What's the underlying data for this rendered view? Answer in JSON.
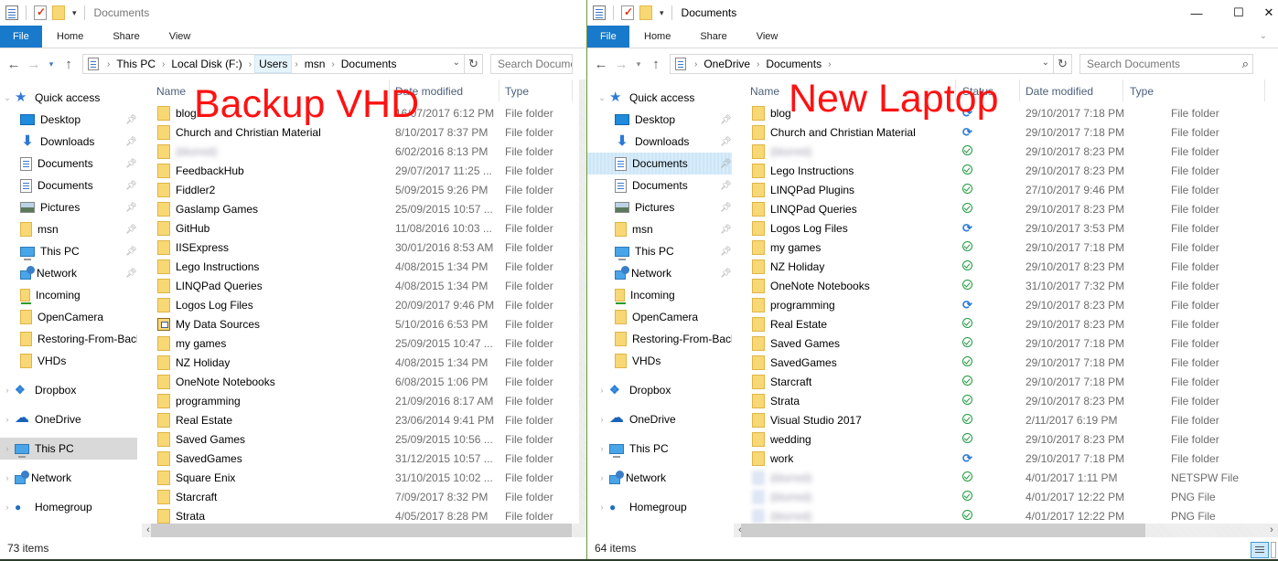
{
  "left_window": {
    "title": "Documents",
    "ribbon_tabs": [
      "File",
      "Home",
      "Share",
      "View"
    ],
    "breadcrumb": [
      "This PC",
      "Local Disk (F:)",
      "Users",
      "msn",
      "Documents"
    ],
    "search_placeholder": "Search Documents",
    "overlay_label": "Backup VHD",
    "columns": {
      "name": "Name",
      "date": "Date modified",
      "type": "Type"
    },
    "sidebar": {
      "quick_access": "Quick access",
      "pinned": [
        {
          "label": "Desktop",
          "icon": "desktop-icon",
          "pinned": true
        },
        {
          "label": "Downloads",
          "icon": "downloads-icon",
          "pinned": true
        },
        {
          "label": "Documents",
          "icon": "documents-icon",
          "pinned": true
        },
        {
          "label": "Documents",
          "icon": "documents-icon",
          "pinned": true
        },
        {
          "label": "Pictures",
          "icon": "pictures-icon",
          "pinned": true
        },
        {
          "label": "msn",
          "icon": "folder-icon",
          "pinned": true
        },
        {
          "label": "This PC",
          "icon": "this-pc-icon",
          "pinned": true
        },
        {
          "label": "Network",
          "icon": "network-icon",
          "pinned": true
        },
        {
          "label": "Incoming",
          "icon": "shared-folder-icon",
          "pinned": false
        },
        {
          "label": "OpenCamera",
          "icon": "folder-icon",
          "pinned": false
        },
        {
          "label": "Restoring-From-Backup",
          "icon": "folder-icon",
          "pinned": false
        },
        {
          "label": "VHDs",
          "icon": "folder-icon",
          "pinned": false
        }
      ],
      "roots": [
        {
          "label": "Dropbox",
          "icon": "dropbox-icon"
        },
        {
          "label": "OneDrive",
          "icon": "onedrive-icon"
        },
        {
          "label": "This PC",
          "icon": "this-pc-icon",
          "selected": true
        },
        {
          "label": "Network",
          "icon": "network-icon"
        },
        {
          "label": "Homegroup",
          "icon": "homegroup-icon"
        }
      ]
    },
    "files": [
      {
        "name": "blog",
        "date": "16/07/2017 6:12 PM",
        "type": "File folder"
      },
      {
        "name": "Church and Christian Material",
        "date": "8/10/2017 8:37 PM",
        "type": "File folder"
      },
      {
        "name": "(blurred)",
        "date": "6/02/2016 8:13 PM",
        "type": "File folder",
        "blurred": true
      },
      {
        "name": "FeedbackHub",
        "date": "29/07/2017 11:25 ...",
        "type": "File folder"
      },
      {
        "name": "Fiddler2",
        "date": "5/09/2015 9:26 PM",
        "type": "File folder"
      },
      {
        "name": "Gaslamp Games",
        "date": "25/09/2015 10:57 ...",
        "type": "File folder"
      },
      {
        "name": "GitHub",
        "date": "11/08/2016 10:03 ...",
        "type": "File folder"
      },
      {
        "name": "IISExpress",
        "date": "30/01/2016 8:53 AM",
        "type": "File folder"
      },
      {
        "name": "Lego Instructions",
        "date": "4/08/2015 1:34 PM",
        "type": "File folder"
      },
      {
        "name": "LINQPad Queries",
        "date": "4/08/2015 1:34 PM",
        "type": "File folder"
      },
      {
        "name": "Logos Log Files",
        "date": "20/09/2017 9:46 PM",
        "type": "File folder"
      },
      {
        "name": "My Data Sources",
        "date": "5/10/2016 6:53 PM",
        "type": "File folder",
        "special": true
      },
      {
        "name": "my games",
        "date": "25/09/2015 10:47 ...",
        "type": "File folder"
      },
      {
        "name": "NZ Holiday",
        "date": "4/08/2015 1:34 PM",
        "type": "File folder"
      },
      {
        "name": "OneNote Notebooks",
        "date": "6/08/2015 1:06 PM",
        "type": "File folder"
      },
      {
        "name": "programming",
        "date": "21/09/2016 8:17 AM",
        "type": "File folder"
      },
      {
        "name": "Real Estate",
        "date": "23/06/2014 9:41 PM",
        "type": "File folder"
      },
      {
        "name": "Saved Games",
        "date": "25/09/2015 10:56 ...",
        "type": "File folder"
      },
      {
        "name": "SavedGames",
        "date": "31/12/2015 10:57 ...",
        "type": "File folder"
      },
      {
        "name": "Square Enix",
        "date": "31/10/2015 10:02 ...",
        "type": "File folder"
      },
      {
        "name": "Starcraft",
        "date": "7/09/2017 8:32 PM",
        "type": "File folder"
      },
      {
        "name": "Strata",
        "date": "4/05/2017 8:28 PM",
        "type": "File folder"
      }
    ],
    "status": "73 items"
  },
  "right_window": {
    "title": "Documents",
    "ribbon_tabs": [
      "File",
      "Home",
      "Share",
      "View"
    ],
    "breadcrumb": [
      "OneDrive",
      "Documents"
    ],
    "search_placeholder": "Search Documents",
    "overlay_label": "New Laptop",
    "columns": {
      "name": "Name",
      "status": "Status",
      "date": "Date modified",
      "type": "Type"
    },
    "window_buttons": {
      "minimize": "—",
      "maximize": "☐",
      "close": "✕"
    },
    "sidebar": {
      "quick_access": "Quick access",
      "pinned": [
        {
          "label": "Desktop",
          "icon": "desktop-icon",
          "pinned": true
        },
        {
          "label": "Downloads",
          "icon": "downloads-icon",
          "pinned": true
        },
        {
          "label": "Documents",
          "icon": "documents-icon",
          "pinned": true,
          "selected": true
        },
        {
          "label": "Documents",
          "icon": "documents-icon",
          "pinned": true
        },
        {
          "label": "Pictures",
          "icon": "pictures-icon",
          "pinned": true
        },
        {
          "label": "msn",
          "icon": "folder-icon",
          "pinned": true
        },
        {
          "label": "This PC",
          "icon": "this-pc-icon",
          "pinned": true
        },
        {
          "label": "Network",
          "icon": "network-icon",
          "pinned": true
        },
        {
          "label": "Incoming",
          "icon": "shared-folder-icon",
          "pinned": false
        },
        {
          "label": "OpenCamera",
          "icon": "folder-icon",
          "pinned": false
        },
        {
          "label": "Restoring-From-Backup",
          "icon": "folder-icon",
          "pinned": false
        },
        {
          "label": "VHDs",
          "icon": "folder-icon",
          "pinned": false
        }
      ],
      "roots": [
        {
          "label": "Dropbox",
          "icon": "dropbox-icon"
        },
        {
          "label": "OneDrive",
          "icon": "onedrive-icon"
        },
        {
          "label": "This PC",
          "icon": "this-pc-icon"
        },
        {
          "label": "Network",
          "icon": "network-icon"
        },
        {
          "label": "Homegroup",
          "icon": "homegroup-icon"
        }
      ]
    },
    "files": [
      {
        "name": "blog",
        "status": "sync",
        "date": "29/10/2017 7:18 PM",
        "type": "File folder"
      },
      {
        "name": "Church and Christian Material",
        "status": "sync",
        "date": "29/10/2017 7:18 PM",
        "type": "File folder"
      },
      {
        "name": "(blurred)",
        "status": "ok",
        "date": "29/10/2017 8:23 PM",
        "type": "File folder",
        "blurred": true
      },
      {
        "name": "Lego Instructions",
        "status": "ok",
        "date": "29/10/2017 8:23 PM",
        "type": "File folder"
      },
      {
        "name": "LINQPad Plugins",
        "status": "ok",
        "date": "27/10/2017 9:46 PM",
        "type": "File folder"
      },
      {
        "name": "LINQPad Queries",
        "status": "ok",
        "date": "29/10/2017 8:23 PM",
        "type": "File folder"
      },
      {
        "name": "Logos Log Files",
        "status": "sync",
        "date": "29/10/2017 3:53 PM",
        "type": "File folder"
      },
      {
        "name": "my games",
        "status": "ok",
        "date": "29/10/2017 7:18 PM",
        "type": "File folder"
      },
      {
        "name": "NZ Holiday",
        "status": "ok",
        "date": "29/10/2017 8:23 PM",
        "type": "File folder"
      },
      {
        "name": "OneNote Notebooks",
        "status": "ok",
        "date": "31/10/2017 7:32 PM",
        "type": "File folder"
      },
      {
        "name": "programming",
        "status": "sync",
        "date": "29/10/2017 8:23 PM",
        "type": "File folder"
      },
      {
        "name": "Real Estate",
        "status": "ok",
        "date": "29/10/2017 8:23 PM",
        "type": "File folder"
      },
      {
        "name": "Saved Games",
        "status": "ok",
        "date": "29/10/2017 7:18 PM",
        "type": "File folder"
      },
      {
        "name": "SavedGames",
        "status": "ok",
        "date": "29/10/2017 7:18 PM",
        "type": "File folder"
      },
      {
        "name": "Starcraft",
        "status": "ok",
        "date": "29/10/2017 7:18 PM",
        "type": "File folder"
      },
      {
        "name": "Strata",
        "status": "ok",
        "date": "29/10/2017 8:23 PM",
        "type": "File folder"
      },
      {
        "name": "Visual Studio 2017",
        "status": "ok",
        "date": "2/11/2017 6:19 PM",
        "type": "File folder"
      },
      {
        "name": "wedding",
        "status": "ok",
        "date": "29/10/2017 8:23 PM",
        "type": "File folder"
      },
      {
        "name": "work",
        "status": "sync",
        "date": "29/10/2017 7:18 PM",
        "type": "File folder"
      },
      {
        "name": "(blurred)",
        "status": "ok",
        "date": "4/01/2017 1:11 PM",
        "type": "NETSPW File",
        "blurred": true,
        "file": true
      },
      {
        "name": "(blurred)",
        "status": "ok",
        "date": "4/01/2017 12:22 PM",
        "type": "PNG File",
        "blurred": true,
        "file": true
      },
      {
        "name": "(blurred)",
        "status": "ok",
        "date": "4/01/2017 12:22 PM",
        "type": "PNG File",
        "blurred": true,
        "file": true
      }
    ],
    "status": "64 items"
  }
}
